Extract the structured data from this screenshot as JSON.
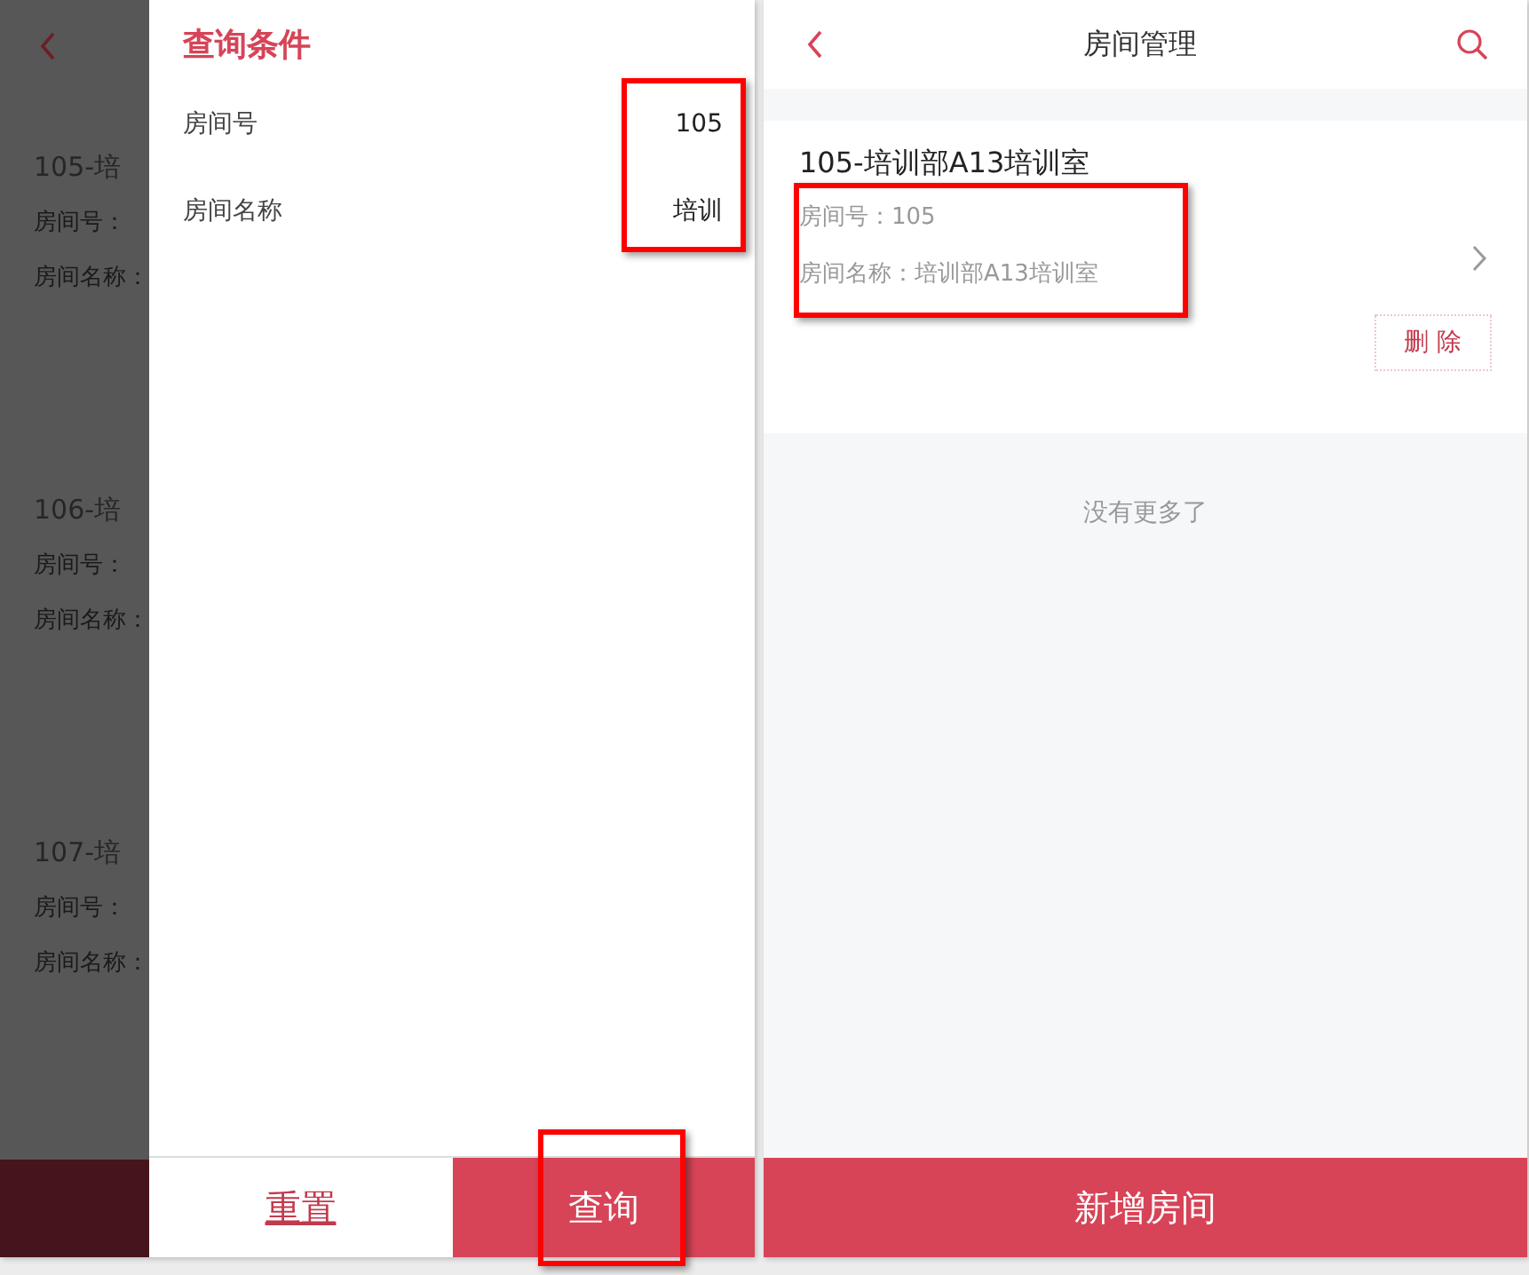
{
  "background_list": {
    "items": [
      {
        "title": "105-培",
        "room_no": "房间号：",
        "room_name": "房间名称："
      },
      {
        "title": "106-培",
        "room_no": "房间号：",
        "room_name": "房间名称："
      },
      {
        "title": "107-培",
        "room_no": "房间号：",
        "room_name": "房间名称："
      }
    ]
  },
  "filter_drawer": {
    "title": "查询条件",
    "highlighted": true,
    "fields": [
      {
        "label": "房间号",
        "value": "105"
      },
      {
        "label": "房间名称",
        "value": "培训"
      }
    ],
    "buttons": [
      {
        "label": "重置",
        "kind": "secondary",
        "highlighted": false
      },
      {
        "label": "查询",
        "kind": "primary",
        "highlighted": true
      }
    ]
  },
  "room_screen": {
    "title": "房间管理",
    "rooms": [
      {
        "title": "105-培训部A13培训室",
        "room_no": "房间号：105",
        "room_name": "房间名称：培训部A13培训室",
        "highlighted": true,
        "action": "删 除"
      }
    ],
    "end_text": "没有更多了",
    "add_button": "新增房间"
  }
}
